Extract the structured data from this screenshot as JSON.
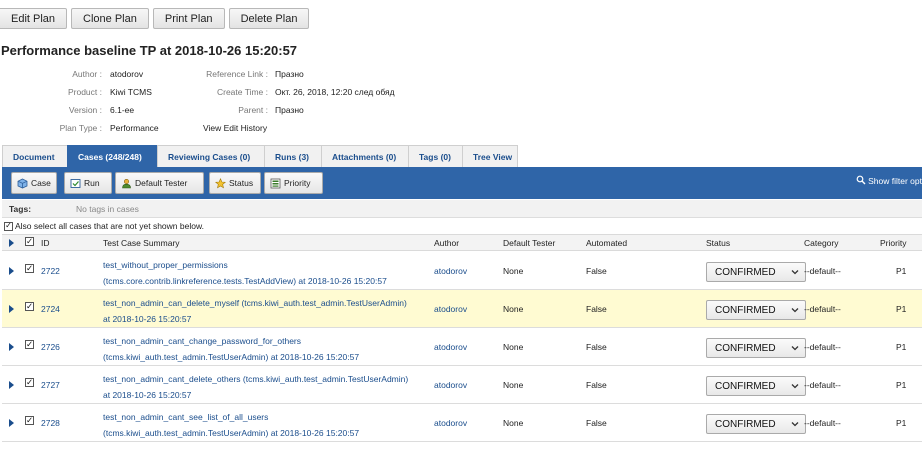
{
  "top_buttons": [
    "Edit Plan",
    "Clone Plan",
    "Print Plan",
    "Delete Plan"
  ],
  "title": "Performance baseline TP at 2018-10-26 15:20:57",
  "meta": {
    "author_label": "Author :",
    "author": "atodorov",
    "product_label": "Product :",
    "product": "Kiwi TCMS",
    "version_label": "Version :",
    "version": "6.1-ee",
    "plan_type_label": "Plan Type :",
    "plan_type": "Performance",
    "reference_link_label": "Reference Link :",
    "reference_link": "Празно",
    "create_time_label": "Create Time :",
    "create_time": "Окт. 26, 2018, 12:20 след обяд",
    "parent_label": "Parent :",
    "parent": "Празно",
    "history_link": "View Edit History"
  },
  "tabs": [
    {
      "label": "Document",
      "active": false
    },
    {
      "label": "Cases (248/248)",
      "active": true
    },
    {
      "label": "Reviewing Cases (0)",
      "active": false
    },
    {
      "label": "Runs (3)",
      "active": false
    },
    {
      "label": "Attachments (0)",
      "active": false
    },
    {
      "label": "Tags (0)",
      "active": false
    },
    {
      "label": "Tree View",
      "active": false
    }
  ],
  "toolbar": {
    "case": "Case",
    "run": "Run",
    "default_tester": "Default Tester",
    "status": "Status",
    "priority": "Priority",
    "show_filter": "Show filter opt"
  },
  "tags": {
    "label": "Tags:",
    "value": "No tags in cases"
  },
  "select_all_label": "Also select all cases that are not yet shown below.",
  "columns": {
    "id": "ID",
    "summary": "Test Case Summary",
    "author": "Author",
    "tester": "Default Tester",
    "automated": "Automated",
    "status": "Status",
    "category": "Category",
    "priority": "Priority"
  },
  "rows": [
    {
      "id": "2722",
      "line1": "test_without_proper_permissions",
      "line2": "(tcms.core.contrib.linkreference.tests.TestAddView) at 2018-10-26 15:20:57",
      "author": "atodorov",
      "tester": "None",
      "automated": "False",
      "status": "CONFIRMED",
      "category": "--default--",
      "priority": "P1",
      "highlight": false
    },
    {
      "id": "2724",
      "line1": "test_non_admin_can_delete_myself (tcms.kiwi_auth.test_admin.TestUserAdmin)",
      "line2": "at 2018-10-26 15:20:57",
      "author": "atodorov",
      "tester": "None",
      "automated": "False",
      "status": "CONFIRMED",
      "category": "--default--",
      "priority": "P1",
      "highlight": true
    },
    {
      "id": "2726",
      "line1": "test_non_admin_cant_change_password_for_others",
      "line2": "(tcms.kiwi_auth.test_admin.TestUserAdmin) at 2018-10-26 15:20:57",
      "author": "atodorov",
      "tester": "None",
      "automated": "False",
      "status": "CONFIRMED",
      "category": "--default--",
      "priority": "P1",
      "highlight": false
    },
    {
      "id": "2727",
      "line1": "test_non_admin_cant_delete_others (tcms.kiwi_auth.test_admin.TestUserAdmin)",
      "line2": "at 2018-10-26 15:20:57",
      "author": "atodorov",
      "tester": "None",
      "automated": "False",
      "status": "CONFIRMED",
      "category": "--default--",
      "priority": "P1",
      "highlight": false
    },
    {
      "id": "2728",
      "line1": "test_non_admin_cant_see_list_of_all_users",
      "line2": "(tcms.kiwi_auth.test_admin.TestUserAdmin) at 2018-10-26 15:20:57",
      "author": "atodorov",
      "tester": "None",
      "automated": "False",
      "status": "CONFIRMED",
      "category": "--default--",
      "priority": "P1",
      "highlight": false
    }
  ]
}
